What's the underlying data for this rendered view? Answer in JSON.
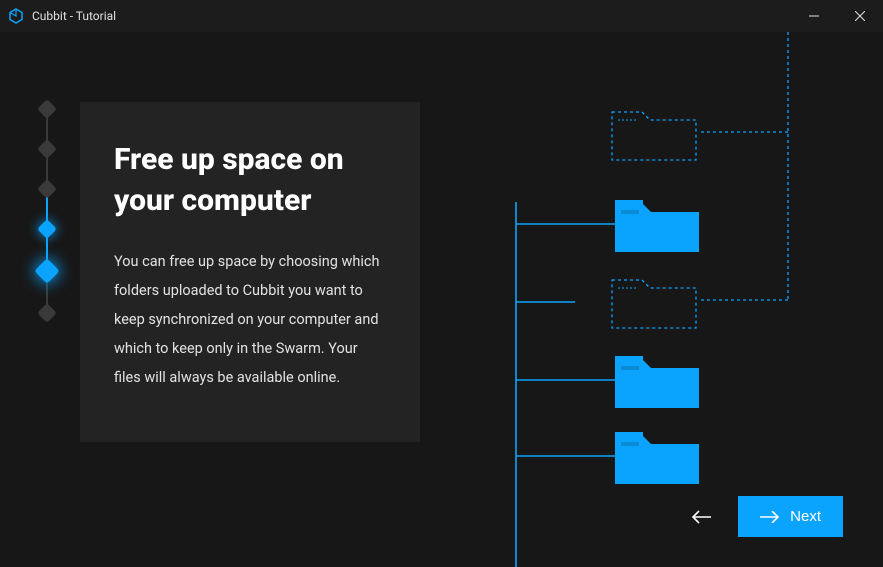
{
  "window": {
    "title": "Cubbit - Tutorial"
  },
  "stepper": {
    "total_steps": 6,
    "active_index": 4
  },
  "content": {
    "heading": "Free up space on your computer",
    "body": "You can free up space by choosing which folders uploaded to Cubbit you want to keep synchronized on your computer and which to keep only in the Swarm. Your files will always be available online."
  },
  "nav": {
    "next_label": "Next"
  },
  "colors": {
    "accent": "#0aa4ff",
    "bg": "#171717",
    "card": "#232323"
  }
}
